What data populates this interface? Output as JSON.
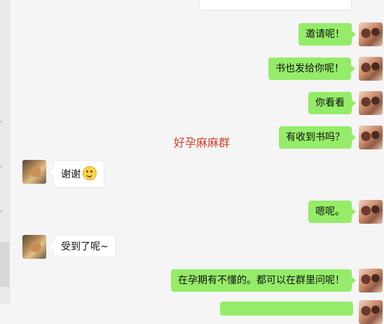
{
  "chat": {
    "watermark": "好孕麻麻群",
    "messages": [
      {
        "sender": "me",
        "text": "邀请呢！"
      },
      {
        "sender": "me",
        "text": "书也发给你呢！"
      },
      {
        "sender": "me",
        "text": "你看看"
      },
      {
        "sender": "me",
        "text": "有收到书吗？"
      },
      {
        "sender": "them",
        "text": "谢谢",
        "emoji": "smile-emoji"
      },
      {
        "sender": "me",
        "text": "嗯呢。"
      },
      {
        "sender": "them",
        "text": "受到了呢~"
      },
      {
        "sender": "me",
        "text": "在孕期有不懂的。都可以在群里问呢！"
      }
    ]
  },
  "colors": {
    "my_bubble": "#95ec69",
    "their_bubble": "#ffffff",
    "background": "#f5f5f5",
    "watermark": "#d0412f"
  }
}
